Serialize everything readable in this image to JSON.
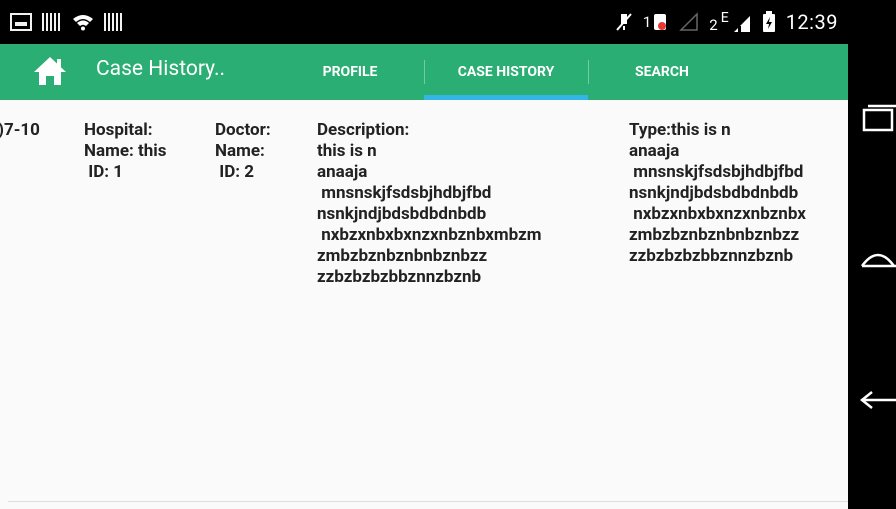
{
  "status_bar": {
    "left_icons": [
      "picture-icon",
      "barcode-icon",
      "wifi-icon",
      "barcode-icon"
    ],
    "right_icons": [
      "mute-icon",
      "sim1-icon",
      "signal-icon",
      "sim2-icon",
      "battery-icon"
    ],
    "sim1_label": "1",
    "sim2_label": "2",
    "network_label": "E",
    "time": "12:39"
  },
  "action_bar": {
    "title": "Case History..",
    "tabs": [
      {
        "label": "PROFILE"
      },
      {
        "label": "CASE HISTORY"
      },
      {
        "label": "SEARCH"
      }
    ],
    "selected_tab": "CASE HISTORY",
    "colors": {
      "bar": "#2aae73",
      "indicator": "#33b5e5"
    }
  },
  "case_row": {
    "date": ")7-10",
    "hospital": "Hospital:\nName: this\n ID: 1",
    "doctor": "Doctor:\nName:\n ID: 2",
    "description": "Description:\nthis is n\nanaaja\n mnsnskjfsdsbjhdbjfbd\nnsnkjndjbdsbdbdnbdb\n nxbzxnbxbxnzxnbznbxmbzm\nzmbzbznbznbnbznbzz\nzzbzbzbzbbznnzbznb",
    "type": "Type:this is n\nanaaja\n mnsnskjfsdsbjhdbjfbd\nnsnkjndjbdsbdbdnbdb\n nxbzxnbxbxnzxnbznbx\nzmbzbznbznbnbznbzz\nzzbzbzbzbbznnzbznb"
  },
  "nav_bar": {
    "buttons": [
      "recents-icon",
      "home-icon",
      "back-icon"
    ]
  }
}
